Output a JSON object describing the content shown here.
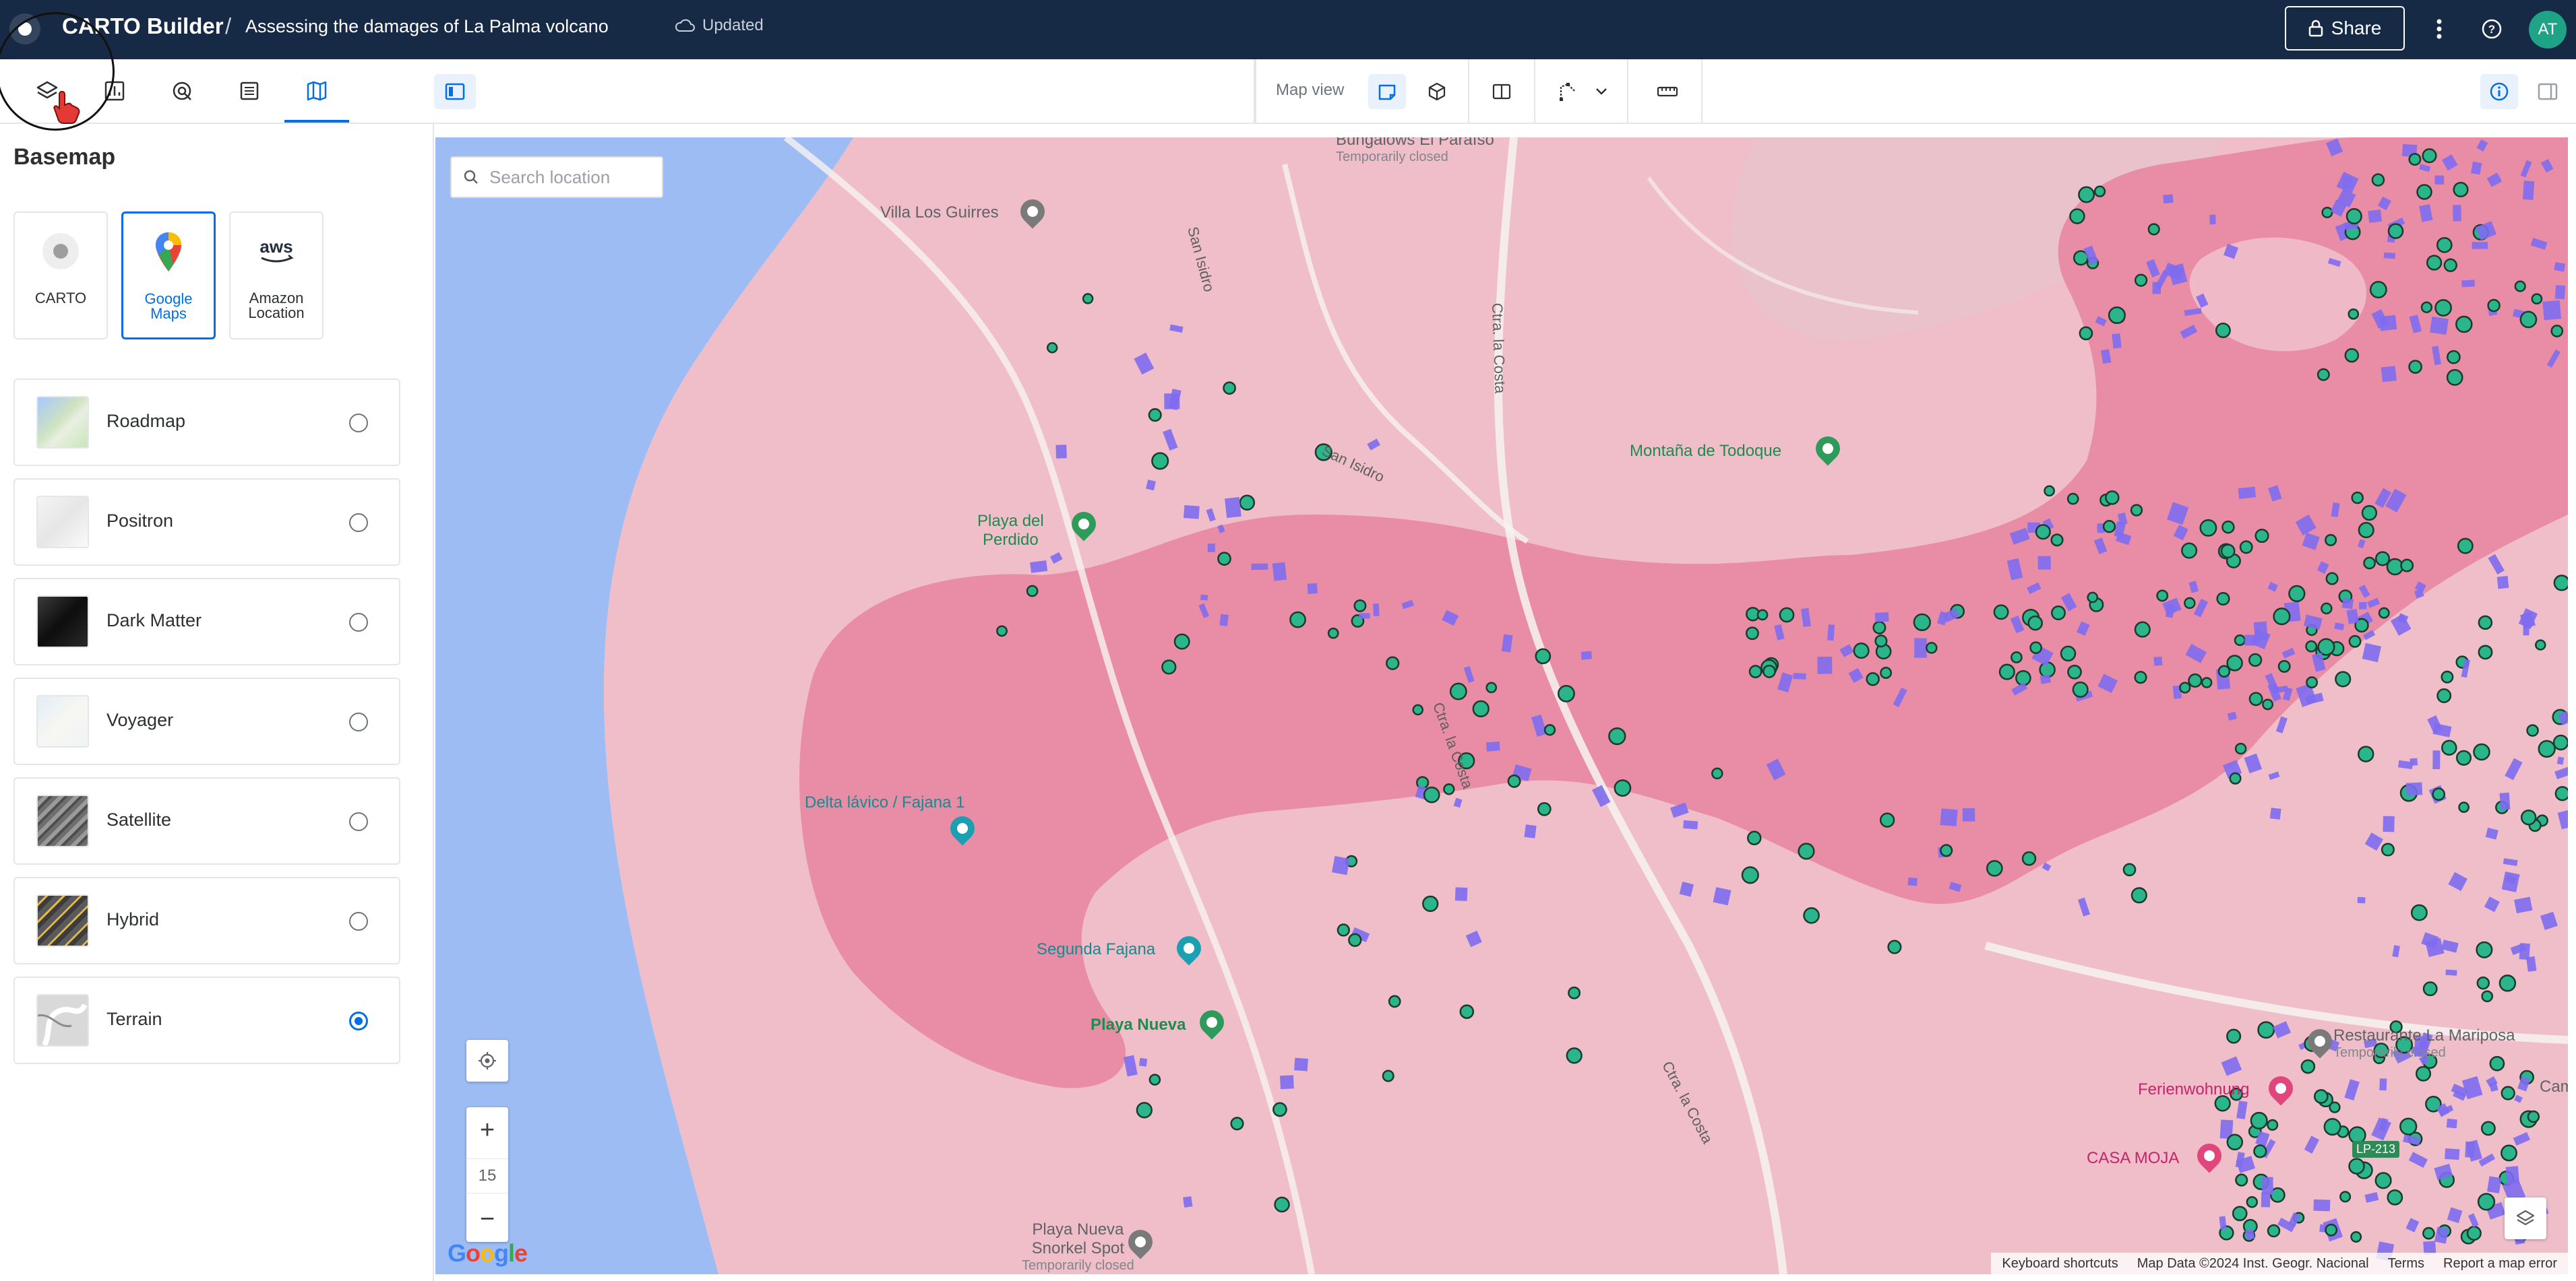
{
  "header": {
    "app_title": "CARTO Builder",
    "separator": "/",
    "map_title": "Assessing the damages of La Palma volcano",
    "save_status": "Updated",
    "share_label": "Share",
    "avatar_initials": "AT",
    "bg_color": "#162945"
  },
  "toolbar": {
    "tabs": [
      {
        "icon": "layers-icon",
        "active": false
      },
      {
        "icon": "widgets-icon",
        "active": false
      },
      {
        "icon": "interactions-icon",
        "active": false
      },
      {
        "icon": "legend-icon",
        "active": false
      },
      {
        "icon": "basemap-icon",
        "active": true
      }
    ],
    "map_view_label": "Map view",
    "accent_color": "#036fe2"
  },
  "basemap_panel": {
    "title": "Basemap",
    "providers": [
      {
        "label": "CARTO",
        "icon": "carto-icon",
        "selected": false
      },
      {
        "label": "Google Maps",
        "icon": "google-maps-pin-icon",
        "selected": true
      },
      {
        "label": "Amazon Location",
        "icon": "aws-icon",
        "selected": false
      }
    ],
    "styles": [
      {
        "label": "Roadmap",
        "checked": false
      },
      {
        "label": "Positron",
        "checked": false
      },
      {
        "label": "Dark Matter",
        "checked": false
      },
      {
        "label": "Voyager",
        "checked": false
      },
      {
        "label": "Satellite",
        "checked": false
      },
      {
        "label": "Hybrid",
        "checked": false
      },
      {
        "label": "Terrain",
        "checked": true
      }
    ]
  },
  "map": {
    "search_placeholder": "Search location",
    "zoom_level": "15",
    "google_logo": "Google",
    "attribution": [
      "Keyboard shortcuts",
      "Map Data ©2024 Inst. Geogr. Nacional",
      "Terms",
      "Report a map error"
    ],
    "places": {
      "bungalows": "Bungalows El Paraíso",
      "bungalows_sub": "Temporarily closed",
      "villa": "Villa Los Guirres",
      "san_isidro_1": "San Isidro",
      "san_isidro_2": "San Isidro",
      "ctra_1": "Ctra. la Costa",
      "ctra_2": "Ctra. la Costa",
      "ctra_3": "Ctra. la Costa",
      "montana": "Montaña de Todoque",
      "playa_perdido_1": "Playa del",
      "playa_perdido_2": "Perdido",
      "delta": "Delta lávico / Fajana 1",
      "segunda": "Segunda Fajana",
      "playa_nueva": "Playa Nueva",
      "snorkel_1": "Playa Nueva",
      "snorkel_2": "Snorkel Spot",
      "snorkel_sub": "Temporarily closed",
      "restaurante": "Restaurante La Mariposa",
      "restaurante_sub": "Temporarily closed",
      "ferienwohnung": "Ferienwohnung",
      "casa": "CASA MOJA",
      "road_lp": "LP-213",
      "cam": "Cam"
    },
    "colors": {
      "lava": "#e8849f",
      "sea": "#9dbcf4",
      "building": "#7e6bf0",
      "point_fill": "#2bb58a"
    }
  }
}
